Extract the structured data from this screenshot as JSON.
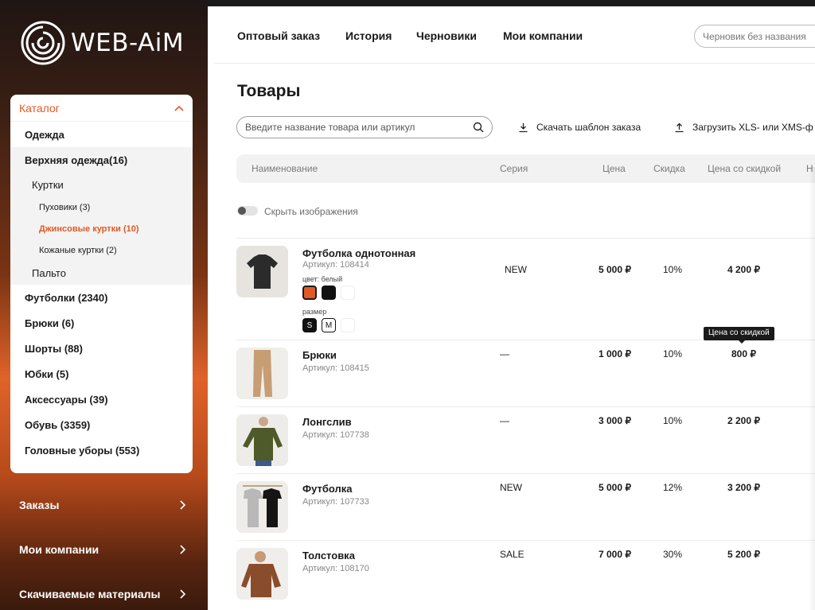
{
  "brand": {
    "logo_text": "WEB-AiM",
    "accent": "#e15a25"
  },
  "sidebar": {
    "catalog_title": "Каталог",
    "categories": [
      "Одежда",
      "Верхняя одежда(16)",
      "Куртки",
      "Пуховики (3)",
      "Джинсовые куртки (10)",
      "Кожаные куртки (2)",
      "Пальто",
      "Футболки (2340)",
      "Брюки (6)",
      "Шорты (88)",
      "Юбки (5)",
      "Аксессуары (39)",
      "Обувь (3359)",
      "Головные уборы (553)"
    ],
    "nav": [
      "Заказы",
      "Мои компании",
      "Скачиваемые материалы"
    ]
  },
  "header": {
    "nav": [
      "Оптовый заказ",
      "История",
      "Черновики",
      "Мои компании"
    ],
    "draft_placeholder": "Черновик без названия"
  },
  "main": {
    "title": "Товары",
    "search_placeholder": "Введите название товара или артикул",
    "download_template": "Скачать шаблон заказа",
    "upload_file": "Загрузить XLS- или XMS-ф",
    "columns": [
      "Наименование",
      "Серия",
      "Цена",
      "Скидка",
      "Цена со скидкой",
      "Н"
    ],
    "hide_images": "Скрыть изображения",
    "tooltip": "Цена со скидкой"
  },
  "products": [
    {
      "name": "Футболка однотонная",
      "article": "Артикул: 108414",
      "series": "NEW",
      "price": "5 000 ₽",
      "discount": "10%",
      "discounted": "4 200 ₽",
      "color_label": "цвет: белый",
      "size_label": "размер",
      "sizes": [
        "S",
        "M"
      ]
    },
    {
      "name": "Брюки",
      "article": "Артикул: 108415",
      "series": "—",
      "price": "1 000 ₽",
      "discount": "10%",
      "discounted": "800 ₽"
    },
    {
      "name": "Лонгслив",
      "article": "Артикул: 107738",
      "series": "—",
      "price": "3 000 ₽",
      "discount": "10%",
      "discounted": "2 200 ₽"
    },
    {
      "name": "Футболка",
      "article": "Артикул: 107733",
      "series": "NEW",
      "price": "5 000 ₽",
      "discount": "12%",
      "discounted": "3 200 ₽"
    },
    {
      "name": "Толстовка",
      "article": "Артикул: 108170",
      "series": "SALE",
      "price": "7 000 ₽",
      "discount": "30%",
      "discounted": "5 200 ₽"
    }
  ]
}
